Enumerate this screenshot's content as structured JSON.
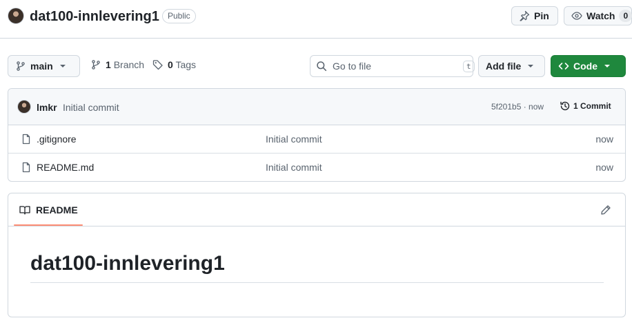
{
  "repo": {
    "name": "dat100-innlevering1",
    "visibility": "Public",
    "pin_label": "Pin",
    "watch_label": "Watch",
    "watch_count": "0"
  },
  "toolbar": {
    "branch_name": "main",
    "branch_count": "1",
    "branch_label": "Branch",
    "tag_count": "0",
    "tag_label": "Tags",
    "search_placeholder": "Go to file",
    "search_shortcut": "t",
    "add_file_label": "Add file",
    "code_label": "Code"
  },
  "latest_commit": {
    "author": "lmkr",
    "message": "Initial commit",
    "sha_time": "5f201b5 · now",
    "commit_count_label": "1 Commit"
  },
  "files": [
    {
      "name": ".gitignore",
      "commit": "Initial commit",
      "time": "now",
      "icon": "file-icon"
    },
    {
      "name": "README.md",
      "commit": "Initial commit",
      "time": "now",
      "icon": "file-icon"
    }
  ],
  "readme": {
    "tab_label": "README",
    "heading": "dat100-innlevering1"
  },
  "colors": {
    "primary_button": "#1f883d",
    "tab_underline": "#fd8c73",
    "border": "#d0d7de"
  }
}
